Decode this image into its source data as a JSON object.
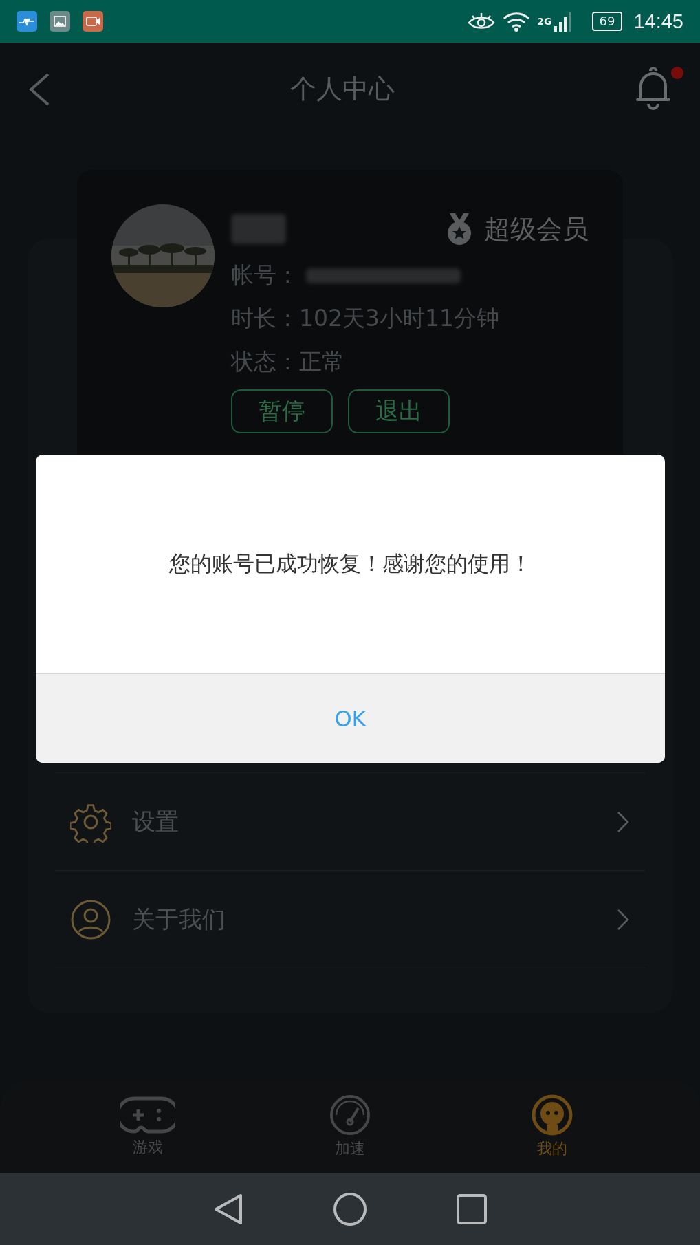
{
  "status_bar": {
    "network": "2G",
    "battery": "69",
    "time": "14:45"
  },
  "header": {
    "title": "个人中心",
    "bell_unread": true
  },
  "profile": {
    "membership": "超级会员",
    "account_label": "帐号：",
    "duration_label": "时长：",
    "duration": "102天3小时11分钟",
    "status_label": "状态：",
    "status": "正常",
    "buttons": [
      "暂停",
      "退出"
    ]
  },
  "menu": [
    {
      "kind": "settings",
      "label": "设置"
    },
    {
      "kind": "about",
      "label": "关于我们"
    }
  ],
  "dialog": {
    "message": "您的账号已成功恢复！感谢您的使用！",
    "button": "OK"
  },
  "bottom_nav": [
    {
      "kind": "game",
      "label": "游戏",
      "selected": false
    },
    {
      "kind": "speed",
      "label": "加速",
      "selected": false
    },
    {
      "kind": "me",
      "label": "我的",
      "selected": true
    }
  ]
}
